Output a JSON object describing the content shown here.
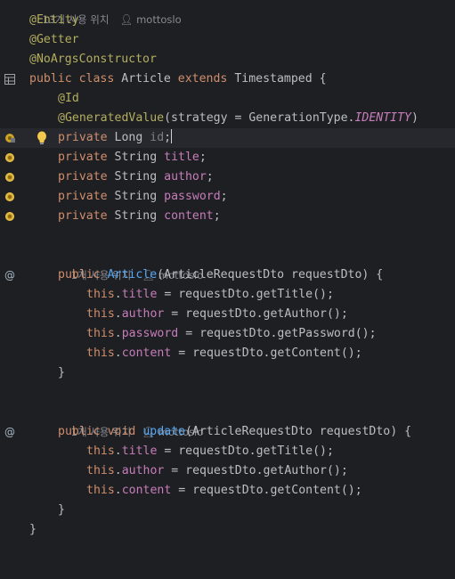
{
  "editor": {
    "usage_hints": {
      "top": {
        "count": "13개 사용 위치",
        "author": "mottoslo"
      },
      "constructor": {
        "count": "1개 사용 위치",
        "author": "mottoslo"
      },
      "update": {
        "count": "1개 사용 위치",
        "author": "mottoslo"
      }
    },
    "code": {
      "ann_entity": "@Entity",
      "ann_getter": "@Getter",
      "ann_noargs": "@NoArgsConstructor",
      "class_public": "public",
      "class_kw": "class",
      "class_name": "Article",
      "class_extends": "extends",
      "class_super": "Timestamped {",
      "ann_id": "@Id",
      "ann_generated": "@GeneratedValue",
      "generated_args_open": "(strategy = GenerationType.",
      "generated_const": "IDENTITY",
      "generated_args_close": ")",
      "private_kw": "private",
      "type_long": "Long",
      "type_string": "String",
      "field_id": "id",
      "field_title": "title",
      "field_author": "author",
      "field_password": "password",
      "field_content": "content",
      "semicolon": ";",
      "ctor_public": "public",
      "ctor_name": "Article",
      "ctor_params": "(ArticleRequestDto requestDto) {",
      "this_kw": "this",
      "dot": ".",
      "assign_title": " = requestDto.getTitle();",
      "assign_author": " = requestDto.getAuthor();",
      "assign_password": " = requestDto.getPassword();",
      "assign_content": " = requestDto.getContent();",
      "close_brace": "}",
      "upd_public": "public",
      "upd_void": "void",
      "upd_name": "update",
      "upd_params": "(ArticleRequestDto requestDto) {"
    },
    "icons": {
      "table": "table-icon",
      "field": "field-icon",
      "bulb": "lightbulb-icon",
      "override": "at-icon",
      "person": "person-icon"
    },
    "colors": {
      "background": "#1e1f22",
      "keyword": "#cf8e6d",
      "annotation": "#b3ae60",
      "field": "#c77dbb",
      "method": "#56a8f5",
      "text": "#bcbec4",
      "hint": "#868a91"
    }
  }
}
